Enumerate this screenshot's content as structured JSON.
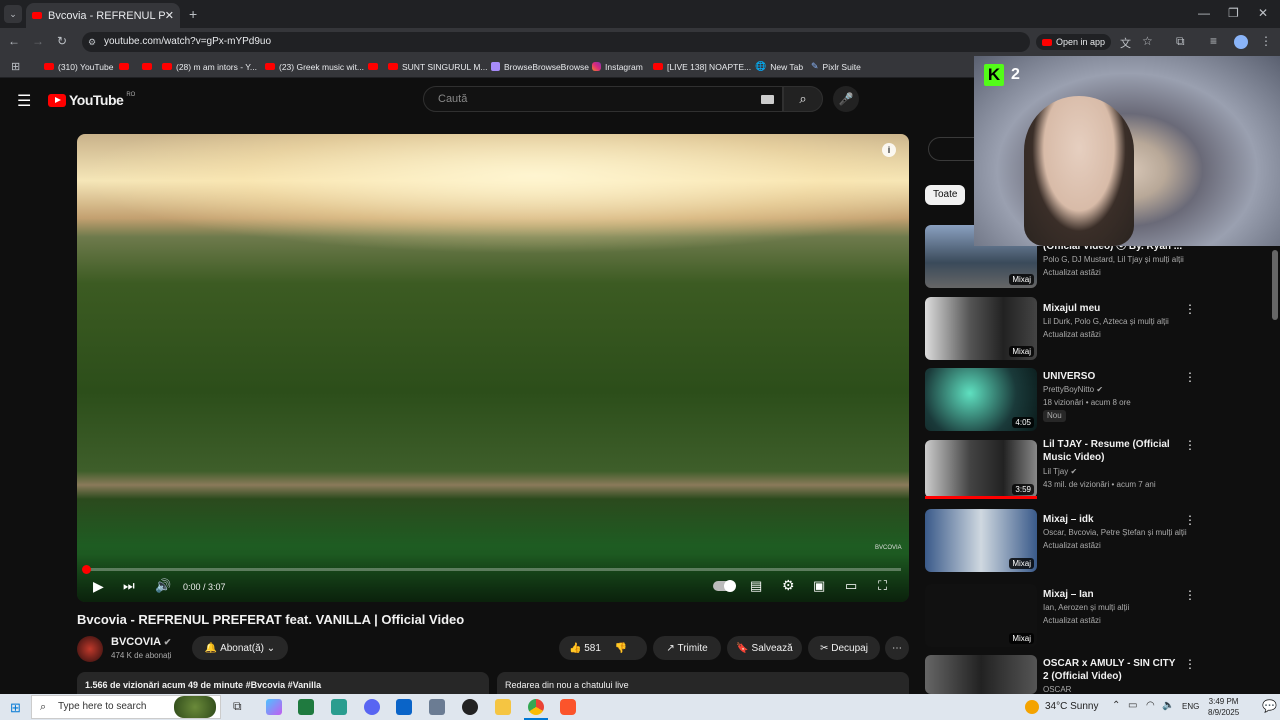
{
  "browser": {
    "tab_title": "Bvcovia - REFRENUL PREFERAT",
    "url": "youtube.com/watch?v=gPx-mYPd9uo",
    "open_in_app": "Open in app",
    "bookmarks": [
      "(310) YouTube",
      "(28) m am intors - Y...",
      "(23) Greek music wit...",
      "SUNT SINGURUL M...",
      "BrowseBrowseBrowse",
      "Instagram",
      "[LIVE 138] NOAPTE...",
      "New Tab",
      "Pixlr Suite"
    ]
  },
  "youtube": {
    "logo_text": "YouTube",
    "region": "RO",
    "search_placeholder": "Caută",
    "video": {
      "title": "Bvcovia - REFRENUL PREFERAT feat. VANILLA | Official Video",
      "time": "0:00 / 3:07",
      "watermark": "BVCOVIA",
      "progress": 0.0
    },
    "channel": {
      "name": "BVCOVIA",
      "subs": "474 K de abonați",
      "subscribe": "Abonat(ă)"
    },
    "actions": {
      "likes": "581",
      "share": "Trimite",
      "save": "Salvează",
      "clip": "Decupaj"
    },
    "desc": "1.566 de vizionări  acum 49 de minute  #Bvcovia #Vanilla",
    "chat": "Redarea din nou a chatului live",
    "filter": "Toate",
    "sidebar": [
      {
        "title": "(Official Video) ⓒ By. Ryan ...",
        "meta1": "Polo G, DJ Mustard, Lil Tjay și mulți alții",
        "meta2": "Actualizat astăzi",
        "badge": "Mixaj"
      },
      {
        "title": "Mixajul meu",
        "meta1": "Lil Durk, Polo G, Azteca și mulți alții",
        "meta2": "Actualizat astăzi",
        "badge": "Mixaj"
      },
      {
        "title": "UNIVERSO",
        "meta1": "PrettyBoyNitto",
        "meta2": "18 vizionări • acum 8 ore",
        "badge": "4:05",
        "extra": "Nou"
      },
      {
        "title": "Lil TJAY - Resume (Official Music Video)",
        "meta1": "Lil Tjay",
        "meta2": "43 mil. de vizionări • acum 7 ani",
        "badge": "3:59"
      },
      {
        "title": "Mixaj – idk",
        "meta1": "Oscar, Bvcovia, Petre Ștefan și mulți alții",
        "meta2": "Actualizat astăzi",
        "badge": "Mixaj"
      },
      {
        "title": "Mixaj – Ian",
        "meta1": "Ian, Aerozen și mulți alții",
        "meta2": "Actualizat astăzi",
        "badge": "Mixaj"
      },
      {
        "title": "OSCAR x AMULY - SIN CITY 2 (Official Video)",
        "meta1": "OSCAR",
        "meta2": "",
        "badge": ""
      }
    ]
  },
  "overlay": {
    "kick_count": "2"
  },
  "taskbar": {
    "search": "Type here to search",
    "weather": "34°C  Sunny",
    "lang": "ENG",
    "time": "3:49 PM",
    "date": "8/9/2025"
  },
  "colors": {
    "accent": "#ff0000",
    "yt_bg": "#0f0f0f",
    "taskbar": "#dfe6ee"
  }
}
